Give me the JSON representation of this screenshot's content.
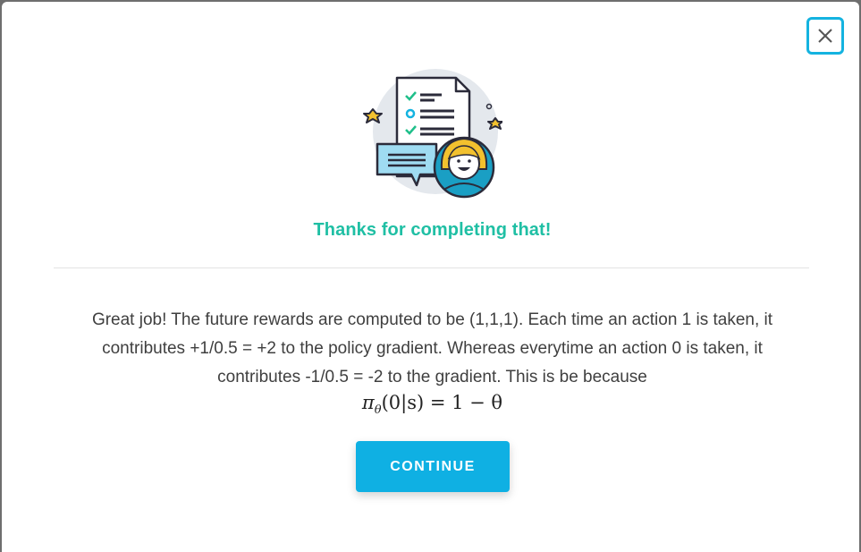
{
  "modal": {
    "close_icon": "close-icon",
    "illustration_icon": "checklist-with-person-illustration",
    "headline": "Thanks for completing that!",
    "message": "Great job! The future rewards are computed to be (1,1,1). Each time an action 1 is taken, it contributes +1/0.5 = +2 to the policy gradient. Whereas everytime an action 0 is taken, it contributes -1/0.5 = -2 to the gradient. This is be because",
    "formula": {
      "pi": "π",
      "theta_sub": "θ",
      "args": "(0|s) = 1 − θ"
    },
    "continue_label": "CONTINUE"
  },
  "colors": {
    "accent": "#0fb0e3",
    "headline": "#1fbfa4",
    "close_border": "#14b3e0"
  }
}
